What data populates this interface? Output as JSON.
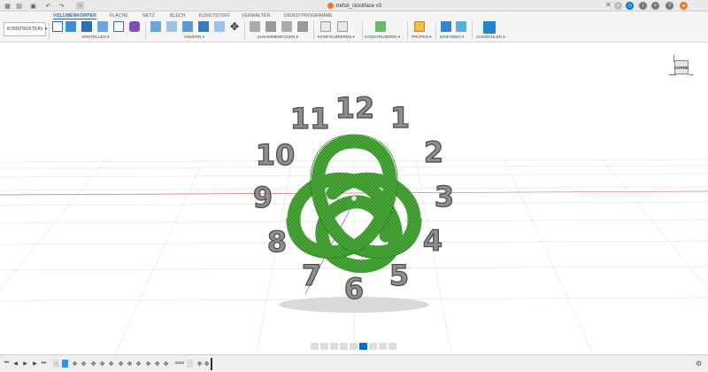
{
  "titlebar": {
    "document_title": "trefoil_clockface v3",
    "close_symbol": "✕",
    "left_icons": [
      "grid-icon",
      "file-icon",
      "undo-icon",
      "redo-icon",
      "home-icon"
    ],
    "right_icons": [
      "plus-icon",
      "clock-icon",
      "help-icon",
      "bell-icon",
      "user-icon"
    ]
  },
  "tabs": [
    "VOLUMENKÖRPER",
    "FLÄCHE",
    "NETZ",
    "BLECH",
    "KUNSTSTOFF",
    "VERWALTEN",
    "DIENSTPROGRAMME"
  ],
  "toolbar": {
    "workspace": "KONSTRUKTION",
    "groups": [
      "ERSTELLEN ▾",
      "ÄNDERN ▾",
      "ZUSAMMENFÜGEN ▾",
      "KONFIGURIEREN ▾",
      "KONSTRUIEREN ▾",
      "PRÜFEN ▾",
      "EINFÜGEN ▾",
      "AUSWÄHLEN ▾"
    ]
  },
  "viewcube": {
    "face_label": "VORNE"
  },
  "clock_numbers": [
    "12",
    "1",
    "2",
    "3",
    "4",
    "5",
    "6",
    "7",
    "8",
    "9",
    "10",
    "11"
  ],
  "timeline": {
    "frame_label": "5558",
    "buttons": [
      "skip-start",
      "step-back",
      "play",
      "step-forward",
      "skip-end"
    ]
  },
  "colors": {
    "accent": "#0a6cc7",
    "knot": "#4caf3b",
    "numeral": "#8e8e8e",
    "grid_red": "#e06b6b"
  }
}
